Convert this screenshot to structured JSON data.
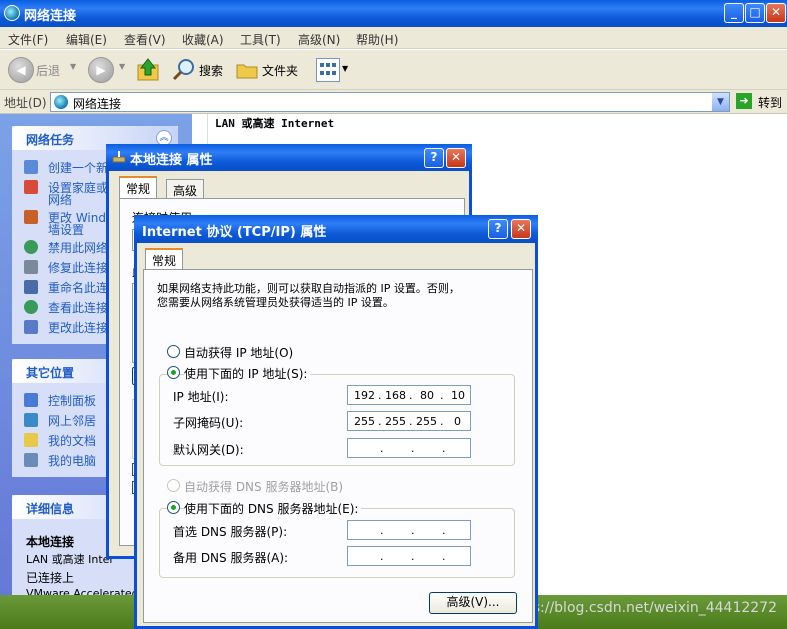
{
  "explorer": {
    "title": "网络连接",
    "menu": [
      "文件(F)",
      "编辑(E)",
      "查看(V)",
      "收藏(A)",
      "工具(T)",
      "高级(N)",
      "帮助(H)"
    ],
    "toolbar": {
      "back": "后退",
      "search": "搜索",
      "folders": "文件夹"
    },
    "address": {
      "label": "地址(D)",
      "value": "网络连接",
      "go": "转到"
    },
    "list_header": "LAN 或高速 Internet"
  },
  "taskpane": {
    "network_tasks": {
      "title": "网络任务",
      "items": [
        "创建一个新",
        "设置家庭或",
        "网络",
        "更改 Windo",
        "墙设置",
        "禁用此网络",
        "修复此连接",
        "重命名此连",
        "查看此连接",
        "更改此连接"
      ]
    },
    "other_places": {
      "title": "其它位置",
      "items": [
        "控制面板",
        "网上邻居",
        "我的文档",
        "我的电脑"
      ]
    },
    "details": {
      "title": "详细信息",
      "name": "本地连接",
      "line1": "LAN 或高速 Inter",
      "line2": "已连接上",
      "line3": "VMware Accelerated"
    }
  },
  "lan_dialog": {
    "title": "本地连接 属性",
    "tabs": [
      "常规",
      "高级"
    ],
    "connect_using": "连接时使用:",
    "section": "此"
  },
  "tcp_dialog": {
    "title": "Internet 协议 (TCP/IP) 属性",
    "tab": "常规",
    "intro_line1": "如果网络支持此功能，则可以获取自动指派的 IP 设置。否则，",
    "intro_line2": "您需要从网络系统管理员处获得适当的 IP 设置。",
    "auto_ip": "自动获得 IP 地址(O)",
    "manual_ip": "使用下面的 IP 地址(S):",
    "ip_label": "IP 地址(I):",
    "ip_value": [
      "192",
      "168",
      "80",
      "10"
    ],
    "mask_label": "子网掩码(U):",
    "mask_value": [
      "255",
      "255",
      "255",
      "0"
    ],
    "gateway_label": "默认网关(D):",
    "auto_dns": "自动获得 DNS 服务器地址(B)",
    "manual_dns": "使用下面的 DNS 服务器地址(E):",
    "dns1_label": "首选 DNS 服务器(P):",
    "dns2_label": "备用 DNS 服务器(A):",
    "advanced_button": "高级(V)..."
  },
  "watermark": "https://blog.csdn.net/weixin_44412272",
  "colors": {
    "title_blue": "#0a5fe0",
    "task_blue": "#215dc6",
    "dialog_bg": "#ece9d8"
  }
}
